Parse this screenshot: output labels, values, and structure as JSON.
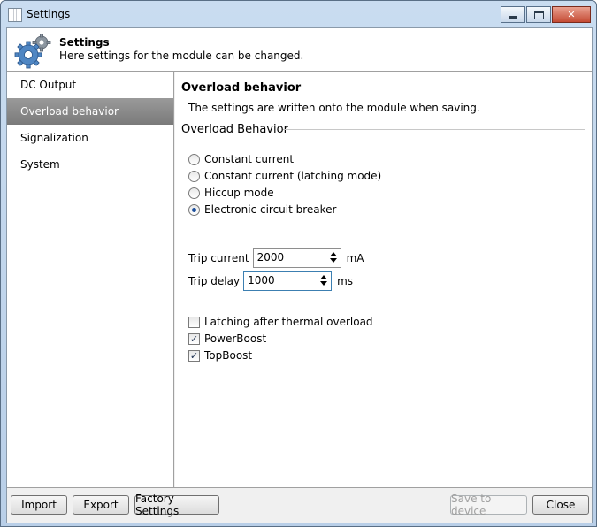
{
  "window": {
    "title": "Settings"
  },
  "header": {
    "title": "Settings",
    "subtitle": "Here settings for the module can be changed."
  },
  "nav": {
    "items": [
      {
        "label": "DC Output",
        "selected": false
      },
      {
        "label": "Overload behavior",
        "selected": true
      },
      {
        "label": "Signalization",
        "selected": false
      },
      {
        "label": "System",
        "selected": false
      }
    ]
  },
  "content": {
    "title": "Overload behavior",
    "note": "The settings are written onto the module when saving.",
    "group_label": "Overload Behavior",
    "options": [
      {
        "label": "Constant current",
        "checked": false
      },
      {
        "label": "Constant current (latching mode)",
        "checked": false
      },
      {
        "label": "Hiccup mode",
        "checked": false
      },
      {
        "label": "Electronic circuit breaker",
        "checked": true
      }
    ],
    "trip_current": {
      "label": "Trip current",
      "value": "2000",
      "unit": "mA"
    },
    "trip_delay": {
      "label": "Trip delay",
      "value": "1000",
      "unit": "ms"
    },
    "checks": [
      {
        "label": "Latching after thermal overload",
        "checked": false
      },
      {
        "label": "PowerBoost",
        "checked": true
      },
      {
        "label": "TopBoost",
        "checked": true
      }
    ]
  },
  "footer": {
    "import_label": "Import",
    "export_label": "Export",
    "factory_label": "Factory Settings",
    "save_label": "Save to device",
    "close_label": "Close"
  },
  "colors": {
    "selection": "#8a8a8a",
    "title_bar": "#c9dcf0",
    "close_button": "#c44a33"
  }
}
